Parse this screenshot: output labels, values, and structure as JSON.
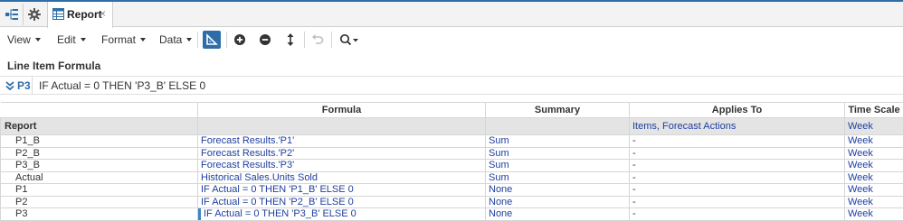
{
  "colors": {
    "accent": "#2f6da8",
    "link": "#1f3fa0",
    "group_bg": "#e4e4e4"
  },
  "tabbar": {
    "icons": [
      "hierarchy-icon",
      "gear-icon"
    ],
    "active_tab": {
      "label": "Report",
      "close": "×",
      "icon": "grid-icon"
    }
  },
  "toolbar": {
    "menus": [
      "View",
      "Edit",
      "Format",
      "Data"
    ],
    "icons": [
      "drafting-triangle-icon",
      "add-circle-icon",
      "remove-circle-icon",
      "sort-arrows-icon",
      "undo-icon",
      "search-icon"
    ]
  },
  "formula_section": {
    "title": "Line Item Formula",
    "selected_item": "P3",
    "formula": "IF Actual = 0 THEN 'P3_B' ELSE 0"
  },
  "grid": {
    "columns": [
      "",
      "Formula",
      "Summary",
      "Applies To",
      "Time Scale"
    ],
    "group": {
      "name": "Report",
      "formula": "",
      "summary": "",
      "applies_to": "Items, Forecast Actions",
      "time_scale": "Week"
    },
    "rows": [
      {
        "name": "P1_B",
        "formula": "Forecast Results.'P1'",
        "summary": "Sum",
        "applies_to": "-",
        "time_scale": "Week"
      },
      {
        "name": "P2_B",
        "formula": "Forecast Results.'P2'",
        "summary": "Sum",
        "applies_to": "-",
        "time_scale": "Week"
      },
      {
        "name": "P3_B",
        "formula": "Forecast Results.'P3'",
        "summary": "Sum",
        "applies_to": "-",
        "time_scale": "Week"
      },
      {
        "name": "Actual",
        "formula": "Historical Sales.Units Sold",
        "summary": "Sum",
        "applies_to": "-",
        "time_scale": "Week"
      },
      {
        "name": "P1",
        "formula": "IF Actual = 0 THEN 'P1_B' ELSE 0",
        "summary": "None",
        "applies_to": "-",
        "time_scale": "Week"
      },
      {
        "name": "P2",
        "formula": "IF Actual = 0 THEN 'P2_B' ELSE 0",
        "summary": "None",
        "applies_to": "-",
        "time_scale": "Week"
      },
      {
        "name": "P3",
        "formula": "IF Actual = 0 THEN 'P3_B' ELSE 0",
        "summary": "None",
        "applies_to": "-",
        "time_scale": "Week"
      }
    ]
  }
}
